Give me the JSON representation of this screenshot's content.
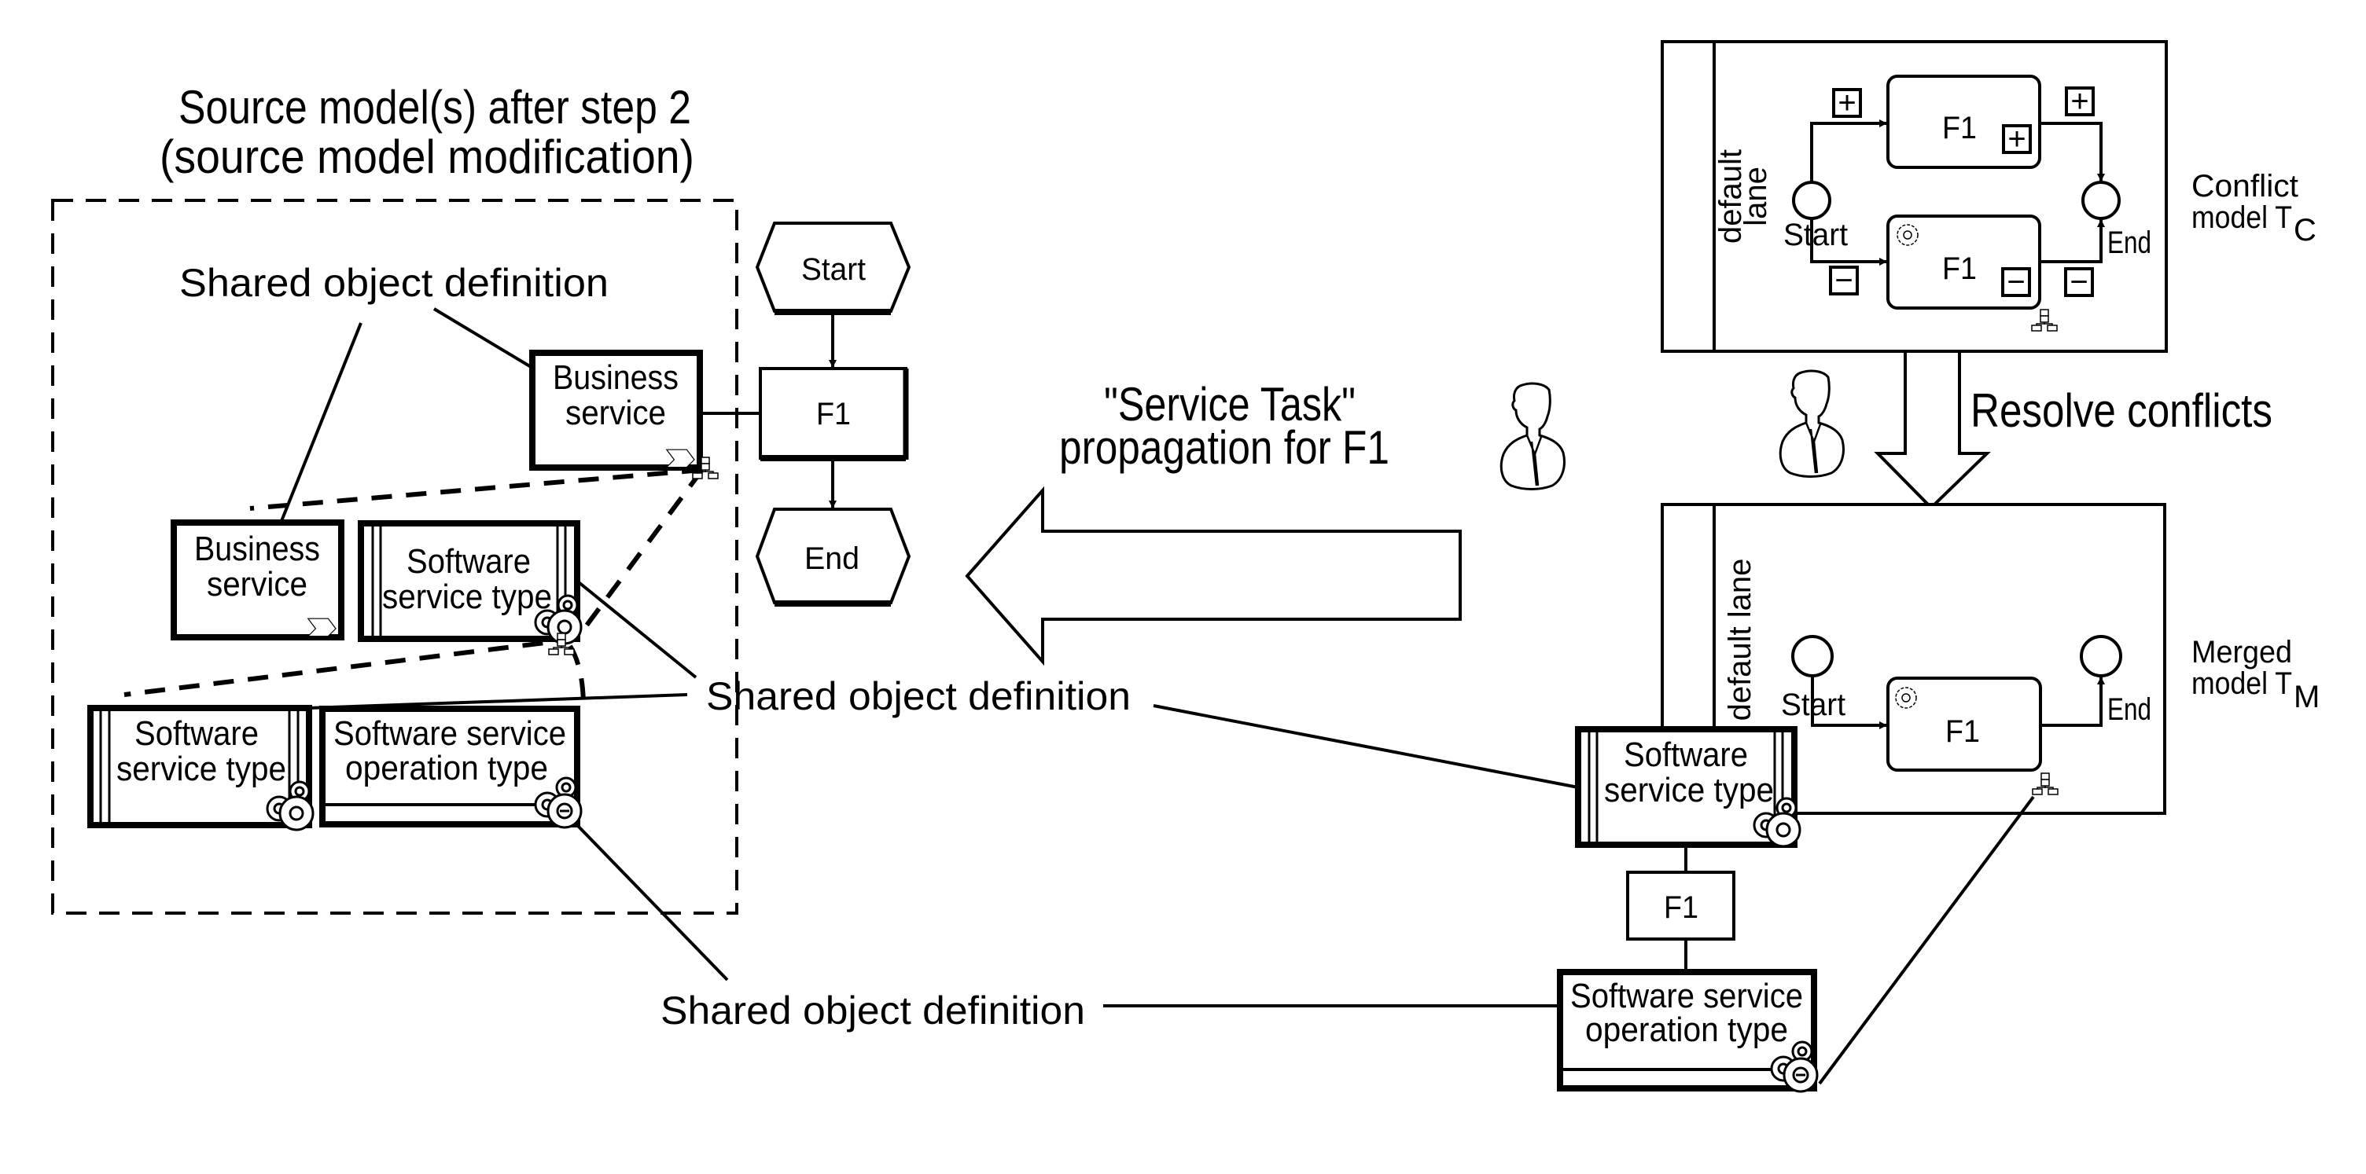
{
  "source": {
    "title_line1": "Source model(s) after step 2",
    "title_line2": "(source model modification)",
    "shared_label_top": "Shared object definition",
    "business_service_1": [
      "Business",
      "service"
    ],
    "business_service_2": [
      "Business",
      "service"
    ],
    "software_service_type_1": [
      "Software",
      "service type"
    ],
    "software_service_type_2": [
      "Software",
      "service type"
    ],
    "software_service_operation_type": [
      "Software service",
      "operation type"
    ],
    "process": {
      "start_label": "Start",
      "function_label": "F1",
      "end_label": "End"
    }
  },
  "propagation": {
    "label_line1": "\"Service Task\"",
    "label_line2": "propagation for F1",
    "actor_icon": "person-icon"
  },
  "shared_label_middle": "Shared object definition",
  "shared_label_bottom": "Shared object definition",
  "conflict_model": {
    "lane_label_line1": "default",
    "lane_label_line2": "lane",
    "start_label": "Start",
    "end_label": "End",
    "task_added_label": "F1",
    "task_removed_label": "F1",
    "added_marker": "+",
    "removed_marker": "−",
    "caption_line1": "Conflict",
    "caption_line2": "model T",
    "caption_subscript": "C"
  },
  "resolve": {
    "label": "Resolve conflicts",
    "actor_icon": "person-icon"
  },
  "merged_model": {
    "lane_label": "default lane",
    "start_label": "Start",
    "end_label": "End",
    "task_label": "F1",
    "caption_line1": "Merged",
    "caption_line2": "model T",
    "caption_subscript": "M",
    "software_service_type": [
      "Software",
      "service type"
    ],
    "function_label": "F1",
    "software_service_operation_type": [
      "Software service",
      "operation type"
    ]
  }
}
